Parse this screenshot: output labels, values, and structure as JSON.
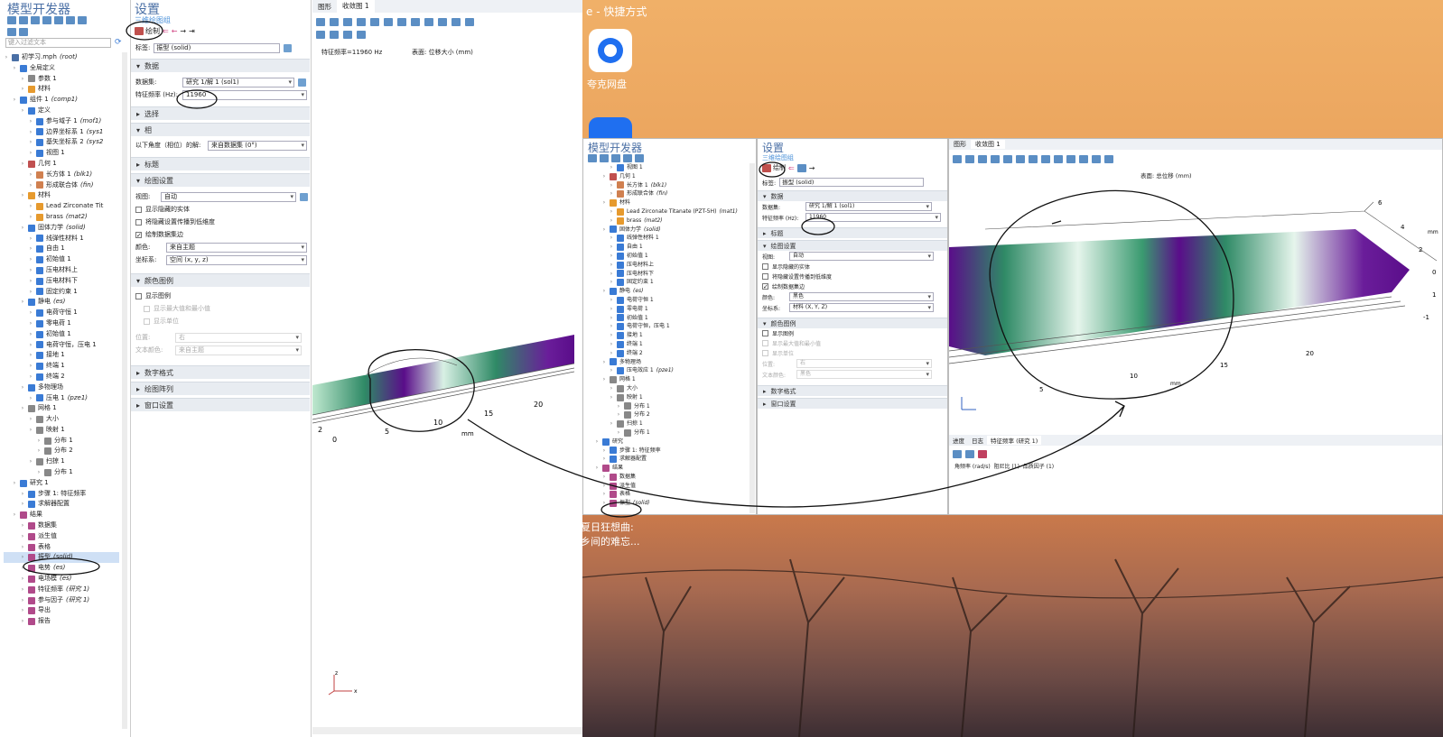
{
  "left": {
    "builder_title": "模型开发器",
    "filter_placeholder": "键入过滤文本",
    "tree": [
      {
        "d": 0,
        "label": "初学习.mph",
        "em": "(root)",
        "c": "#4a6fa5",
        "sel": false
      },
      {
        "d": 1,
        "label": "全局定义",
        "em": "",
        "c": "#3a7bd5",
        "sel": false
      },
      {
        "d": 2,
        "label": "参数 1",
        "em": "",
        "c": "#888",
        "sel": false
      },
      {
        "d": 2,
        "label": "材料",
        "em": "",
        "c": "#e69a2e",
        "sel": false
      },
      {
        "d": 1,
        "label": "组件 1",
        "em": "(comp1)",
        "c": "#3a7bd5",
        "sel": false
      },
      {
        "d": 2,
        "label": "定义",
        "em": "",
        "c": "#3a7bd5",
        "sel": false
      },
      {
        "d": 3,
        "label": "参与域子 1",
        "em": "(mof1)",
        "c": "#3a7bd5",
        "sel": false
      },
      {
        "d": 3,
        "label": "边界坐标系 1",
        "em": "(sys1",
        "c": "#3a7bd5",
        "sel": false
      },
      {
        "d": 3,
        "label": "基矢坐标系 2",
        "em": "(sys2",
        "c": "#3a7bd5",
        "sel": false
      },
      {
        "d": 3,
        "label": "视图 1",
        "em": "",
        "c": "#3a7bd5",
        "sel": false
      },
      {
        "d": 2,
        "label": "几何 1",
        "em": "",
        "c": "#c05050",
        "sel": false
      },
      {
        "d": 3,
        "label": "长方体 1",
        "em": "(blk1)",
        "c": "#d08050",
        "sel": false
      },
      {
        "d": 3,
        "label": "形成联合体",
        "em": "(fin)",
        "c": "#d08050",
        "sel": false
      },
      {
        "d": 2,
        "label": "材料",
        "em": "",
        "c": "#e69a2e",
        "sel": false
      },
      {
        "d": 3,
        "label": "Lead Zirconate Tit",
        "em": "",
        "c": "#e69a2e",
        "sel": false
      },
      {
        "d": 3,
        "label": "brass",
        "em": "(mat2)",
        "c": "#e69a2e",
        "sel": false
      },
      {
        "d": 2,
        "label": "固体力学",
        "em": "(solid)",
        "c": "#3a7bd5",
        "sel": false
      },
      {
        "d": 3,
        "label": "线弹性材料 1",
        "em": "",
        "c": "#3a7bd5",
        "sel": false
      },
      {
        "d": 3,
        "label": "自由 1",
        "em": "",
        "c": "#3a7bd5",
        "sel": false
      },
      {
        "d": 3,
        "label": "初始值 1",
        "em": "",
        "c": "#3a7bd5",
        "sel": false
      },
      {
        "d": 3,
        "label": "压电材料上",
        "em": "",
        "c": "#3a7bd5",
        "sel": false
      },
      {
        "d": 3,
        "label": "压电材料下",
        "em": "",
        "c": "#3a7bd5",
        "sel": false
      },
      {
        "d": 3,
        "label": "固定约束 1",
        "em": "",
        "c": "#3a7bd5",
        "sel": false
      },
      {
        "d": 2,
        "label": "静电",
        "em": "(es)",
        "c": "#3a7bd5",
        "sel": false
      },
      {
        "d": 3,
        "label": "电荷守恒 1",
        "em": "",
        "c": "#3a7bd5",
        "sel": false
      },
      {
        "d": 3,
        "label": "零电荷 1",
        "em": "",
        "c": "#3a7bd5",
        "sel": false
      },
      {
        "d": 3,
        "label": "初始值 1",
        "em": "",
        "c": "#3a7bd5",
        "sel": false
      },
      {
        "d": 3,
        "label": "电荷守恒，压电 1",
        "em": "",
        "c": "#3a7bd5",
        "sel": false
      },
      {
        "d": 3,
        "label": "接地 1",
        "em": "",
        "c": "#3a7bd5",
        "sel": false
      },
      {
        "d": 3,
        "label": "终端 1",
        "em": "",
        "c": "#3a7bd5",
        "sel": false
      },
      {
        "d": 3,
        "label": "终端 2",
        "em": "",
        "c": "#3a7bd5",
        "sel": false
      },
      {
        "d": 2,
        "label": "多物理场",
        "em": "",
        "c": "#3a7bd5",
        "sel": false
      },
      {
        "d": 3,
        "label": "压电 1",
        "em": "(pze1)",
        "c": "#3a7bd5",
        "sel": false
      },
      {
        "d": 2,
        "label": "网格 1",
        "em": "",
        "c": "#888",
        "sel": false
      },
      {
        "d": 3,
        "label": "大小",
        "em": "",
        "c": "#888",
        "sel": false
      },
      {
        "d": 3,
        "label": "映射 1",
        "em": "",
        "c": "#888",
        "sel": false
      },
      {
        "d": 4,
        "label": "分布 1",
        "em": "",
        "c": "#888",
        "sel": false
      },
      {
        "d": 4,
        "label": "分布 2",
        "em": "",
        "c": "#888",
        "sel": false
      },
      {
        "d": 3,
        "label": "扫掠 1",
        "em": "",
        "c": "#888",
        "sel": false
      },
      {
        "d": 4,
        "label": "分布 1",
        "em": "",
        "c": "#888",
        "sel": false
      },
      {
        "d": 1,
        "label": "研究 1",
        "em": "",
        "c": "#3a7bd5",
        "sel": false
      },
      {
        "d": 2,
        "label": "步骤 1: 特征频率",
        "em": "",
        "c": "#3a7bd5",
        "sel": false
      },
      {
        "d": 2,
        "label": "求解器配置",
        "em": "",
        "c": "#3a7bd5",
        "sel": false
      },
      {
        "d": 1,
        "label": "结果",
        "em": "",
        "c": "#b04a8a",
        "sel": false
      },
      {
        "d": 2,
        "label": "数据集",
        "em": "",
        "c": "#b04a8a",
        "sel": false
      },
      {
        "d": 2,
        "label": "派生值",
        "em": "",
        "c": "#b04a8a",
        "sel": false
      },
      {
        "d": 2,
        "label": "表格",
        "em": "",
        "c": "#b04a8a",
        "sel": false
      },
      {
        "d": 2,
        "label": "振型",
        "em": "(solid)",
        "c": "#b04a8a",
        "sel": true
      },
      {
        "d": 2,
        "label": "电势",
        "em": "(es)",
        "c": "#b04a8a",
        "sel": false
      },
      {
        "d": 2,
        "label": "电场模",
        "em": "(es)",
        "c": "#b04a8a",
        "sel": false
      },
      {
        "d": 2,
        "label": "特征频率",
        "em": "(研究 1)",
        "c": "#b04a8a",
        "sel": false
      },
      {
        "d": 2,
        "label": "参与因子",
        "em": "(研究 1)",
        "c": "#b04a8a",
        "sel": false
      },
      {
        "d": 2,
        "label": "导出",
        "em": "",
        "c": "#b04a8a",
        "sel": false
      },
      {
        "d": 2,
        "label": "报告",
        "em": "",
        "c": "#b04a8a",
        "sel": false
      }
    ]
  },
  "settings": {
    "title": "设置",
    "subtitle": "三维绘图组",
    "plot_btn": "绘制",
    "label_caption": "标签:",
    "label_value": "振型 (solid)",
    "sec_data": "数据",
    "dataset_caption": "数据集:",
    "dataset_value": "研究 1/解 1 (sol1)",
    "freq_caption": "特征频率 (Hz):",
    "freq_value": "11960",
    "sec_select": "选择",
    "sec_phase": "相",
    "phase_caption": "以下角度（相位）的解:",
    "phase_value": "来自数据集 (0°)",
    "sec_title": "标题",
    "sec_plot": "绘图设置",
    "view_caption": "视图:",
    "view_value": "自动",
    "cb1": "显示隐藏的实体",
    "cb2": "将隐藏设置传播到低维度",
    "cb3": "绘制数据集边",
    "color_caption": "颜色:",
    "color_value": "来自主题",
    "frame_caption": "坐标系:",
    "frame_value": "空间 (x, y, z)",
    "sec_legend": "颜色图例",
    "legend_cb1": "显示图例",
    "legend_cb2": "显示最大值和最小值",
    "legend_cb3": "显示单位",
    "pos_caption": "位置:",
    "pos_value": "右",
    "textcolor_caption": "文本颜色:",
    "textcolor_value": "来自主题",
    "sec_num": "数字格式",
    "sec_order": "绘图阵列",
    "sec_window": "窗口设置"
  },
  "graphics": {
    "tab1": "图形",
    "tab2": "收敛图 1",
    "freq_text": "特征频率=11960 Hz",
    "surface_text": "表面: 位移大小 (mm)",
    "axis_unit": "mm",
    "ticks": [
      "0",
      "5",
      "10",
      "15",
      "20",
      "2"
    ]
  },
  "desktop": {
    "title_fragment": "e - 快捷方式",
    "app_label": "夸克网盘",
    "caption1": "夏日狂想曲:",
    "caption2": "乡间的难忘..."
  },
  "right": {
    "builder_title": "模型开发器",
    "settings_title": "设置",
    "subtitle": "三维绘图组",
    "plot_btn": "绘制",
    "label_caption": "标签:",
    "label_value": "振型 (solid)",
    "sec_data": "数据",
    "dataset_caption": "数据集:",
    "dataset_value": "研究 1/解 1 (sol1)",
    "freq_caption": "特征频率 (Hz):",
    "freq_value": "11960",
    "sec_title": "标题",
    "sec_plot": "绘图设置",
    "view_caption": "视图:",
    "view_value": "自动",
    "cb1": "显示隐藏的实体",
    "cb2": "将隐藏设置传播到低维度",
    "cb3": "绘制数据集边",
    "color_caption": "颜色:",
    "color_value": "黑色",
    "frame_caption": "坐标系:",
    "frame_value": "材料 (X, Y, Z)",
    "sec_legend": "颜色图例",
    "legend_cb1": "显示图例",
    "legend_cb2": "显示最大值和最小值",
    "legend_cb3": "显示单位",
    "pos_caption": "位置:",
    "pos_value": "右",
    "textcolor_caption": "文本颜色:",
    "textcolor_value": "黑色",
    "sec_num": "数字格式",
    "sec_window": "窗口设置",
    "tab1": "图形",
    "tab2": "收敛图 1",
    "surface_text": "表面: 总位移 (mm)",
    "bottom_tabs": [
      "进度",
      "日志",
      "特征频率 (研究 1)"
    ],
    "table_header": "角频率 (rad/s)  阻尼比 (1)  品质因子 (1)",
    "axis_unit": "mm",
    "ticks_x": [
      "5",
      "10",
      "15",
      "20"
    ],
    "ticks_y": [
      "6",
      "4",
      "2",
      "0",
      "1",
      "-1"
    ],
    "tree": [
      {
        "d": 3,
        "label": "视图 1",
        "em": "",
        "c": "#3a7bd5"
      },
      {
        "d": 2,
        "label": "几何 1",
        "em": "",
        "c": "#c05050"
      },
      {
        "d": 3,
        "label": "长方体 1",
        "em": "(blk1)",
        "c": "#d08050"
      },
      {
        "d": 3,
        "label": "形成联合体",
        "em": "(fin)",
        "c": "#d08050"
      },
      {
        "d": 2,
        "label": "材料",
        "em": "",
        "c": "#e69a2e"
      },
      {
        "d": 3,
        "label": "Lead Zirconate Titanate (PZT-5H)",
        "em": "(mat1)",
        "c": "#e69a2e"
      },
      {
        "d": 3,
        "label": "brass",
        "em": "(mat2)",
        "c": "#e69a2e"
      },
      {
        "d": 2,
        "label": "固体力学",
        "em": "(solid)",
        "c": "#3a7bd5"
      },
      {
        "d": 3,
        "label": "线弹性材料 1",
        "em": "",
        "c": "#3a7bd5"
      },
      {
        "d": 3,
        "label": "自由 1",
        "em": "",
        "c": "#3a7bd5"
      },
      {
        "d": 3,
        "label": "初始值 1",
        "em": "",
        "c": "#3a7bd5"
      },
      {
        "d": 3,
        "label": "压电材料上",
        "em": "",
        "c": "#3a7bd5"
      },
      {
        "d": 3,
        "label": "压电材料下",
        "em": "",
        "c": "#3a7bd5"
      },
      {
        "d": 3,
        "label": "固定约束 1",
        "em": "",
        "c": "#3a7bd5"
      },
      {
        "d": 2,
        "label": "静电",
        "em": "(es)",
        "c": "#3a7bd5"
      },
      {
        "d": 3,
        "label": "电荷守恒 1",
        "em": "",
        "c": "#3a7bd5"
      },
      {
        "d": 3,
        "label": "零电荷 1",
        "em": "",
        "c": "#3a7bd5"
      },
      {
        "d": 3,
        "label": "初始值 1",
        "em": "",
        "c": "#3a7bd5"
      },
      {
        "d": 3,
        "label": "电荷守恒，压电 1",
        "em": "",
        "c": "#3a7bd5"
      },
      {
        "d": 3,
        "label": "接地 1",
        "em": "",
        "c": "#3a7bd5"
      },
      {
        "d": 3,
        "label": "终端 1",
        "em": "",
        "c": "#3a7bd5"
      },
      {
        "d": 3,
        "label": "终端 2",
        "em": "",
        "c": "#3a7bd5"
      },
      {
        "d": 2,
        "label": "多物理场",
        "em": "",
        "c": "#3a7bd5"
      },
      {
        "d": 3,
        "label": "压电效应 1",
        "em": "(pze1)",
        "c": "#3a7bd5"
      },
      {
        "d": 2,
        "label": "网格 1",
        "em": "",
        "c": "#888"
      },
      {
        "d": 3,
        "label": "大小",
        "em": "",
        "c": "#888"
      },
      {
        "d": 3,
        "label": "映射 1",
        "em": "",
        "c": "#888"
      },
      {
        "d": 4,
        "label": "分布 1",
        "em": "",
        "c": "#888"
      },
      {
        "d": 4,
        "label": "分布 2",
        "em": "",
        "c": "#888"
      },
      {
        "d": 3,
        "label": "扫掠 1",
        "em": "",
        "c": "#888"
      },
      {
        "d": 4,
        "label": "分布 1",
        "em": "",
        "c": "#888"
      },
      {
        "d": 1,
        "label": "研究",
        "em": "",
        "c": "#3a7bd5"
      },
      {
        "d": 2,
        "label": "步骤 1: 特征频率",
        "em": "",
        "c": "#3a7bd5"
      },
      {
        "d": 2,
        "label": "求解器配置",
        "em": "",
        "c": "#3a7bd5"
      },
      {
        "d": 1,
        "label": "结果",
        "em": "",
        "c": "#b04a8a"
      },
      {
        "d": 2,
        "label": "数据集",
        "em": "",
        "c": "#b04a8a"
      },
      {
        "d": 2,
        "label": "派生值",
        "em": "",
        "c": "#b04a8a"
      },
      {
        "d": 2,
        "label": "表格",
        "em": "",
        "c": "#b04a8a"
      },
      {
        "d": 2,
        "label": "振型",
        "em": "(solid)",
        "c": "#b04a8a"
      }
    ]
  },
  "colors": {
    "accent": "#4a6fa5",
    "section": "#e8ecf1",
    "selection": "#cfe0f5",
    "annotation": "#111111"
  }
}
